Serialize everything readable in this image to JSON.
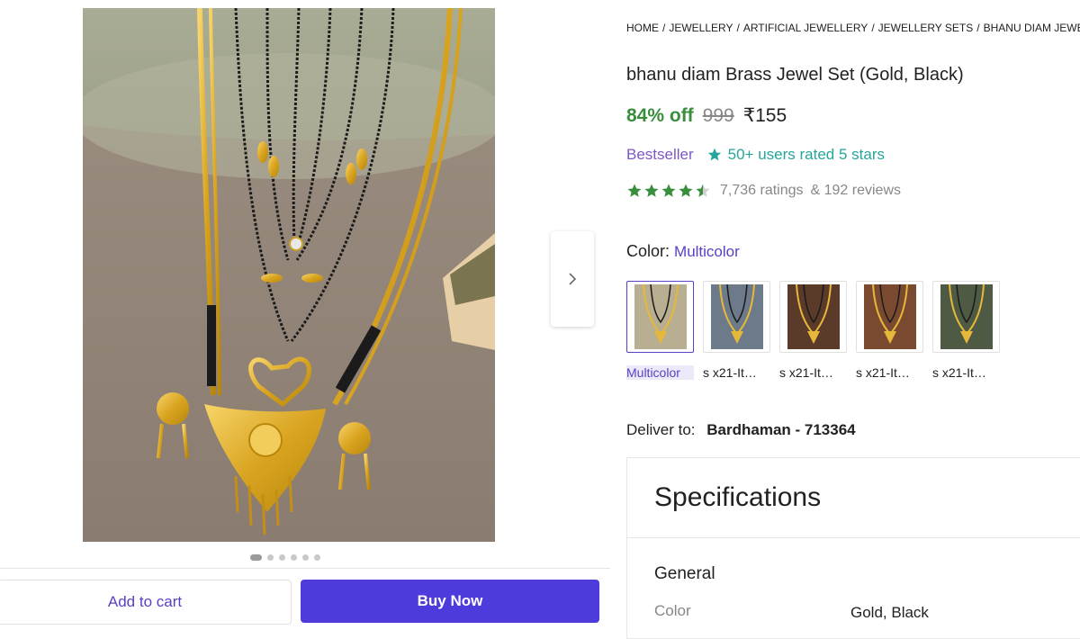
{
  "breadcrumb": [
    "HOME",
    "JEWELLERY",
    "ARTIFICIAL JEWELLERY",
    "JEWELLERY SETS",
    "BHANU DIAM JEWE"
  ],
  "product": {
    "title": "bhanu diam Brass Jewel Set (Gold, Black)",
    "discount": "84% off",
    "mrp": "999",
    "price": "₹155"
  },
  "badges": {
    "bestseller": "Bestseller",
    "rated": "50+ users rated 5 stars"
  },
  "rating": {
    "value": 4.5,
    "ratings": "7,736 ratings",
    "reviews": "& 192 reviews",
    "star_color": "#388e3c"
  },
  "color": {
    "label": "Color:",
    "value": "Multicolor",
    "options": [
      {
        "label": "Multicolor",
        "bg": "#b8ae92"
      },
      {
        "label": "s x21-It…",
        "bg": "#6d7a8a"
      },
      {
        "label": "s x21-It…",
        "bg": "#5a3a28"
      },
      {
        "label": "s x21-It…",
        "bg": "#7a4a30"
      },
      {
        "label": "s x21-It…",
        "bg": "#4f5a45"
      }
    ]
  },
  "delivery": {
    "label": "Deliver to:",
    "location": "Bardhaman - 713364"
  },
  "specs": {
    "heading": "Specifications",
    "section": "General",
    "rows": [
      {
        "key": "Color",
        "value": "Gold, Black"
      }
    ]
  },
  "gallery": {
    "count": 6,
    "active": 0
  },
  "actions": {
    "add_to_cart": "Add to cart",
    "buy_now": "Buy Now"
  },
  "colors": {
    "accent": "#5b3fc4",
    "buy_button": "#4d3bdc",
    "discount_green": "#388e3c",
    "bestseller_purple": "#7e57c2",
    "rated_teal": "#26a69a"
  }
}
